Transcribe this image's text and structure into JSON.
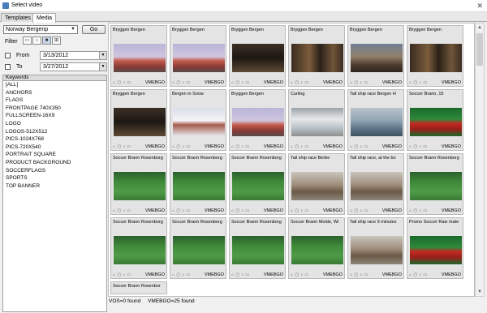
{
  "window": {
    "title": "Select video",
    "close_glyph": "✕"
  },
  "tabs": [
    {
      "label": "Templates",
      "active": false
    },
    {
      "label": "Media",
      "active": true
    }
  ],
  "location": {
    "value": "Norway Bergenp",
    "go_label": "Go"
  },
  "filter": {
    "label": "Filter",
    "buttons": [
      {
        "icon": "image-icon",
        "glyph": "▭",
        "pressed": false
      },
      {
        "icon": "music-icon",
        "glyph": "♪",
        "pressed": false
      },
      {
        "icon": "video-icon",
        "glyph": "■",
        "pressed": true
      },
      {
        "icon": "grid-icon",
        "glyph": "⊞",
        "pressed": false
      }
    ]
  },
  "date_from": {
    "label": "From",
    "value": "3/13/2012",
    "checked": false
  },
  "date_to": {
    "label": "To",
    "value": "3/27/2012",
    "checked": false
  },
  "keywords": {
    "header": "Keywords",
    "items": [
      "[ALL]",
      "ANCHORS",
      "FLAGS",
      "FRONTPAGE 740X350",
      "FULLSCREEN-16X9",
      "LOGO",
      "LOGOS-512X512",
      "PICS-1024X768",
      "PICS-720X540",
      "PORTRAIT SQUARE",
      "PRODUCT BACKGROUND",
      "SOCCERFLAGS",
      "SPORTS",
      "TOP BANNER"
    ]
  },
  "media": [
    {
      "title": "Bryggen Bergen",
      "source": "VMEBGO",
      "icon": "city-photo"
    },
    {
      "title": "Bryggen Bergen",
      "source": "VMEBGO",
      "icon": "city-photo"
    },
    {
      "title": "Bryggen Bergen",
      "source": "VMEBGO",
      "icon": "dark-photo"
    },
    {
      "title": "Bryggen Bergen",
      "source": "VMEBGO",
      "icon": "alley-photo"
    },
    {
      "title": "Bryggen Bergen",
      "source": "VMEBGO",
      "icon": "harbor-photo"
    },
    {
      "title": "Bryggen Bergen",
      "source": "VMEBGO",
      "icon": "alley-photo"
    },
    {
      "title": "Bryggen Bergen",
      "source": "VMEBGO",
      "icon": "dark-photo"
    },
    {
      "title": "Bergen in Snow",
      "source": "VMEBGO",
      "icon": "snow-photo"
    },
    {
      "title": "Bryggen Bergen",
      "source": "VMEBGO",
      "icon": "city-photo"
    },
    {
      "title": "Curling",
      "source": "VMEBGO",
      "icon": "curling-photo"
    },
    {
      "title": "Tall ship race Bergen H",
      "source": "VMEBGO",
      "icon": "sea-photo"
    },
    {
      "title": "Soccer Brann, 15",
      "source": "VMEBGO",
      "icon": "player-photo"
    },
    {
      "title": "Soccer Brann Rosenborg",
      "source": "VMEBGO",
      "icon": "pitch-photo"
    },
    {
      "title": "Soccer Brann Rosenborg",
      "source": "VMEBGO",
      "icon": "pitch-photo"
    },
    {
      "title": "Soccer Brann Rosenborg",
      "source": "VMEBGO",
      "icon": "pitch-photo"
    },
    {
      "title": "Tall ship race Berbe",
      "source": "VMEBGO",
      "icon": "ship-photo"
    },
    {
      "title": "Tall ship race, at the bo",
      "source": "VMEBGO",
      "icon": "ship-photo"
    },
    {
      "title": "Soccer Brann Rosenborg",
      "source": "VMEBGO",
      "icon": "pitch-photo"
    },
    {
      "title": "Soccer Brann Rosenborg",
      "source": "VMEBGO",
      "icon": "pitch-photo"
    },
    {
      "title": "Soccer Brann Rosenborg",
      "source": "VMEBGO",
      "icon": "pitch-photo"
    },
    {
      "title": "Soccer Brann Rosenborg",
      "source": "VMEBGO",
      "icon": "pitch-photo"
    },
    {
      "title": "Soccer Brann Molde, Wi",
      "source": "VMEBGO",
      "icon": "pitch-photo"
    },
    {
      "title": "Tall ship race 9 minutes",
      "source": "VMEBGO",
      "icon": "ship-photo"
    },
    {
      "title": "Promo Soccer Raw mate",
      "source": "VMEBGO",
      "icon": "player-photo"
    },
    {
      "title": "Soccer Brann Rosenbor",
      "source": "VMEBGO",
      "icon": "pitch-photo"
    }
  ],
  "media_toolbar": {
    "glyphs": "⌂ ▢ ♪ ▭"
  },
  "status": {
    "vos": "VOS=0 found",
    "vmebgo": "VMEBGO=25 found"
  }
}
